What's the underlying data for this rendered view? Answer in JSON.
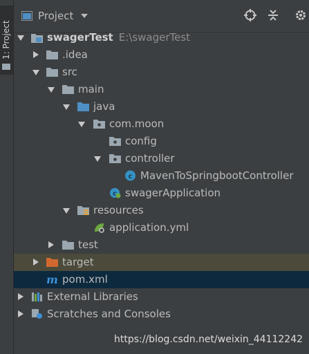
{
  "stripe": {
    "tab_label": "1: Project"
  },
  "header": {
    "title": "Project"
  },
  "tree": [
    {
      "label": "swagerTest",
      "path": "E:\\swagerTest"
    },
    {
      "label": ".idea"
    },
    {
      "label": "src"
    },
    {
      "label": "main"
    },
    {
      "label": "java"
    },
    {
      "label": "com.moon"
    },
    {
      "label": "config"
    },
    {
      "label": "controller"
    },
    {
      "label": "MavenToSpringbootController"
    },
    {
      "label": "swagerApplication"
    },
    {
      "label": "resources"
    },
    {
      "label": "application.yml"
    },
    {
      "label": "test"
    },
    {
      "label": "target"
    },
    {
      "label": "pom.xml"
    },
    {
      "label": "External Libraries"
    },
    {
      "label": "Scratches and Consoles"
    }
  ],
  "watermark": "https://blog.csdn.net/weixin_44112242",
  "colors": {
    "background": "#3c3f41",
    "selected": "#0d293e",
    "target_highlight": "#4b4a3b",
    "folder": "#9aa7b0",
    "source_folder": "#4f8fc4",
    "excluded_folder": "#d1692f"
  }
}
